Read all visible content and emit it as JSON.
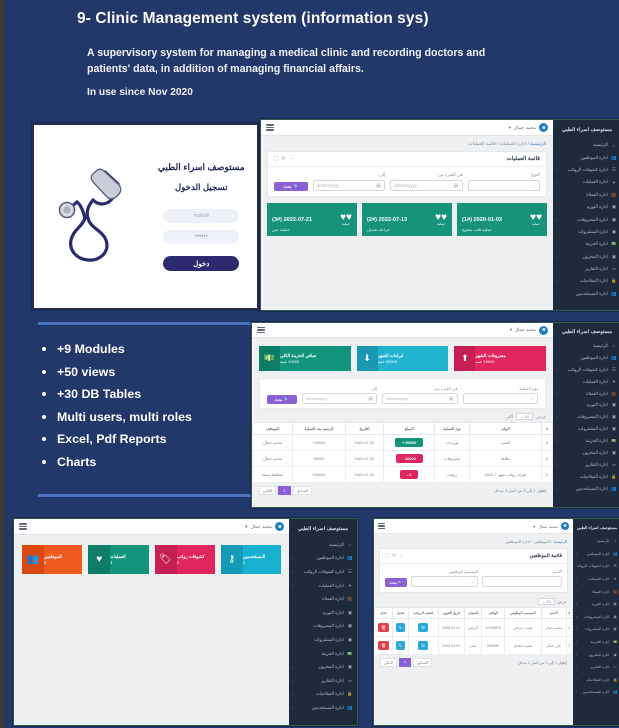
{
  "slide": {
    "title": "9- Clinic Management system (information sys)",
    "description": "A supervisory system for managing a medical clinic and recording doctors and patients' data, in addition of managing financial affairs.",
    "since": "In use since Nov 2020",
    "features": [
      "+9 Modules",
      "+50 views",
      "+30 DB Tables",
      "Multi users, multi roles",
      "Excel, Pdf Reports",
      "Charts"
    ],
    "colors": {
      "background": "#22376a",
      "divider": "#4a72c0",
      "text": "#ffffff"
    }
  },
  "login_shot": {
    "brand": "مستوصف اسراء الطبي",
    "subtitle": "تسجيل الدخول",
    "username_value": "mahdi",
    "password_value": "••••••",
    "submit_label": "دخول",
    "illustration": "stethoscope-illustration",
    "illustration_color": "#2a2a6e"
  },
  "sidebar": {
    "brand": "مستوصف اسراء الطبي",
    "items": [
      {
        "label": "الرئيسية",
        "icon": "home-icon",
        "caret": ""
      },
      {
        "label": "ادارة الموظفين",
        "icon": "users-icon",
        "caret": "‹"
      },
      {
        "label": "ادارة كشوفات الرواتب",
        "icon": "list-icon",
        "caret": "‹"
      },
      {
        "label": "ادارة العمليات",
        "icon": "heartbeat-icon",
        "caret": "‹"
      },
      {
        "label": "ادارة العملاء",
        "icon": "briefcase-icon",
        "caret": "‹"
      },
      {
        "label": "ادارة التوريد",
        "icon": "box-icon",
        "caret": "‹"
      },
      {
        "label": "ادارة المصروفات",
        "icon": "box-icon",
        "caret": "‹"
      },
      {
        "label": "ادارة المشتروات",
        "icon": "box-icon",
        "caret": "‹"
      },
      {
        "label": "ادارة الخزينة",
        "icon": "money-icon",
        "caret": "‹"
      },
      {
        "label": "ادارة المخزون",
        "icon": "box-icon",
        "caret": "‹"
      },
      {
        "label": "ادارة التقارير",
        "icon": "file-icon",
        "caret": "‹"
      },
      {
        "label": "ادارة الصلاحيات",
        "icon": "lock-icon",
        "caret": "‹"
      },
      {
        "label": "ادارة المستخدمين",
        "icon": "users-icon",
        "caret": "‹"
      }
    ]
  },
  "topbar": {
    "menu_icon": "hamburger-icon",
    "user_name": "محمد جمال",
    "caret": "▾",
    "avatar": "user-avatar"
  },
  "operations_shot": {
    "breadcrumb": [
      "الرئيسية",
      "ادارة العمليات",
      "قائمة العمليات"
    ],
    "panel_title": "قائمة العمليات",
    "panel_tools": [
      "minimize-icon",
      "refresh-icon",
      "expand-icon"
    ],
    "filters": [
      {
        "label": "النوع",
        "value": "",
        "type": "select"
      },
      {
        "label": "في الفترة من",
        "value": "dd/mm/yyyy",
        "type": "date"
      },
      {
        "label": "إلى",
        "value": "dd/mm/yyyy",
        "type": "date"
      }
    ],
    "search_label": "بحث",
    "search_icon": "search-icon",
    "cards": [
      {
        "date": "2020-01-02",
        "ref": "(1#)",
        "subtitle": "عملية قلب مفتوح",
        "badge": "عملية",
        "icon": "heartbeat-icon"
      },
      {
        "date": "2022-07-13",
        "ref": "(2#)",
        "subtitle": "جراحة تجميل",
        "badge": "عملية",
        "icon": "heartbeat-icon"
      },
      {
        "date": "2022-07-21",
        "ref": "(3#)",
        "subtitle": "عملية عين",
        "badge": "عملية",
        "icon": "heartbeat-icon"
      }
    ]
  },
  "treasury_shot": {
    "stat_cards": [
      {
        "title": "مصروفات الشهر",
        "value": "10000 جنيه",
        "icon": "arrow-up-icon",
        "color": "#e0255f",
        "icon_bg": "#c51f53"
      },
      {
        "title": "ايرادات الشهر",
        "value": "50000 جنيه",
        "icon": "arrow-down-icon",
        "color": "#20b2cf",
        "icon_bg": "#1a97b1"
      },
      {
        "title": "صافي الخزينة الكلي",
        "value": "40000 جنيه",
        "icon": "money-icon",
        "color": "#12957d",
        "icon_bg": "#0d7d68"
      }
    ],
    "filters": [
      {
        "label": "نوع العملية",
        "value": "",
        "type": "select"
      },
      {
        "label": "في الفترة من",
        "value": "dd/mm/yyyy",
        "type": "date"
      },
      {
        "label": "إلى",
        "value": "dd/mm/yyyy",
        "type": "date"
      }
    ],
    "search_label": "بحث",
    "show_label": "عرض",
    "show_value": "10",
    "show_suffix": "أكثر",
    "table": {
      "headers": [
        "#",
        "البيان",
        "نوع العملية",
        "المبلغ",
        "التاريخ",
        "الرصيد بعد العملية",
        "الموظف"
      ],
      "rows": [
        {
          "no": "3",
          "desc": "كشف",
          "type": "توريدات",
          "amount": "50000 +",
          "amount_color": "#12957d",
          "date": "2022-07-22",
          "balance": "740000",
          "staff": "محمد جمال"
        },
        {
          "no": "2",
          "desc": "نظافة",
          "type": "مصروفات",
          "amount": "10000 -",
          "amount_color": "#e0255f",
          "date": "2022-07-22",
          "balance": "90000",
          "staff": "محمد جمال"
        },
        {
          "no": "1",
          "desc": "صرف رواتب شهر 7-2022",
          "type": "رواتب",
          "amount": "0 -",
          "amount_color": "#e0255f",
          "date": "2022-07-20",
          "balance": "100000",
          "staff": "محافظ جمعة"
        }
      ]
    },
    "pager": {
      "info": "إظهار 1 إلى 3 من أصل 3 مدخل",
      "prev": "السابق",
      "current": "1",
      "next": "التالي"
    }
  },
  "home_shot": {
    "tiles": [
      {
        "label": "المستخدمين",
        "count": "1",
        "icon": "key-icon",
        "color": "#17b0d0",
        "icon_bg": "#139ab7"
      },
      {
        "label": "كشوفات رواتب",
        "count": "2",
        "icon": "tag-icon",
        "color": "#e0255f",
        "icon_bg": "#c51f53"
      },
      {
        "label": "العمليات",
        "count": "1",
        "icon": "heartbeat-icon",
        "color": "#12957d",
        "icon_bg": "#0d7d68"
      },
      {
        "label": "الموظفين",
        "count": "2",
        "icon": "users-icon",
        "color": "#f05a1e",
        "icon_bg": "#d94a12"
      }
    ]
  },
  "employees_shot": {
    "breadcrumb": [
      "الرئيسية",
      "الموظفين",
      "ادارة الموظفين"
    ],
    "panel_title": "قائمة الموظفين",
    "panel_tools": [
      "minimize-icon",
      "refresh-icon",
      "expand-icon"
    ],
    "filters": [
      {
        "label": "الاسم",
        "value": "",
        "type": "text"
      },
      {
        "label": "المسمى الوظيفي",
        "value": "",
        "type": "select"
      }
    ],
    "search_label": "بحث",
    "show_label": "عرض",
    "show_value": "10",
    "table": {
      "headers": [
        "#",
        "الاسم",
        "المسمى الوظيفي",
        "الهاتف",
        "العنوان",
        "تاريخ التعيين",
        "كشف الرواتب",
        "تعديل",
        "حذف"
      ],
      "rows": [
        {
          "no": "1",
          "name": "محمد جمال",
          "job": "طبيب جراحي",
          "phone": "01100876",
          "address": "الرياض",
          "hire_date": "2020-01-01",
          "payroll_icon": "list-icon",
          "edit_icon": "edit-icon",
          "delete_icon": "trash-icon"
        },
        {
          "no": "2",
          "name": "علي جمال",
          "job": "طبيب اطفال",
          "phone": "090909",
          "address": "مصر",
          "hire_date": "2020-01-01",
          "payroll_icon": "list-icon",
          "edit_icon": "edit-icon",
          "delete_icon": "trash-icon"
        }
      ]
    },
    "pager": {
      "info": "إظهار 1 إلى 2 من أصل 2 مدخل",
      "prev": "السابق",
      "current": "1",
      "next": "التالي"
    }
  }
}
